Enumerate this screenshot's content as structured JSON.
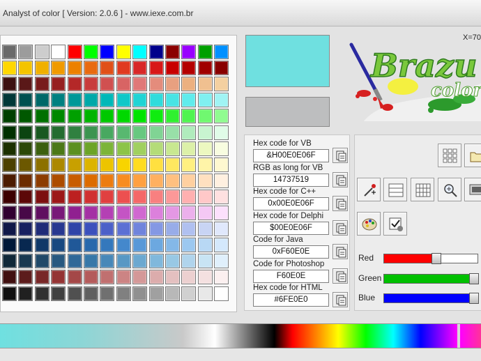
{
  "window": {
    "title": "Analyst of color [ Version: 2.0.6 ] - www.iexe.com.br"
  },
  "coordinates": "X=70",
  "logo": {
    "word1": "Brazu",
    "word2": "color"
  },
  "preview": {
    "selected_color": "#6FE0E0",
    "previous_color": "#BDBEBF"
  },
  "codes": [
    {
      "label": "Hex code for VB",
      "value": "&H00E0E06F"
    },
    {
      "label": "RGB as long for VB",
      "value": "14737519"
    },
    {
      "label": "Hex code for C++",
      "value": "0x00E0E06F"
    },
    {
      "label": "Hex code for Delphi",
      "value": "$00E0E06F"
    },
    {
      "label": "Code for Java",
      "value": "0xF60E0E"
    },
    {
      "label": "Code for Photoshop",
      "value": "F60E0E"
    },
    {
      "label": "Hex code for HTML",
      "value": "#6FE0E0"
    }
  ],
  "sliders": [
    {
      "label": "Red",
      "color": "#ff0000",
      "level": 0.55
    },
    {
      "label": "Green",
      "color": "#00c000",
      "level": 1.0
    },
    {
      "label": "Blue",
      "color": "#0000ff",
      "level": 1.0
    }
  ],
  "tools": [
    "grid-view-icon",
    "folder-icon",
    "eyedropper-icon",
    "list-view-icon",
    "small-grid-icon",
    "zoom-icon",
    "monitor-icon",
    "paint-palette-icon",
    "checkbox-options-icon"
  ],
  "palette_rows": [
    [
      "#6a6a6a",
      "#9c9c9c",
      "#cdcdcd",
      "#ffffff",
      "#ff0000",
      "#00ff00",
      "#0000ff",
      "#ffff00",
      "#00ffff",
      "#00008b",
      "#8b0000",
      "#9900ff",
      "#00a000",
      "#0090ff"
    ],
    [
      "#ffd700",
      "#f4c400",
      "#f0b000",
      "#f09a00",
      "#ec8000",
      "#e86a10",
      "#e05018",
      "#e03a20",
      "#d82828",
      "#d81818",
      "#c80000",
      "#b40000",
      "#a00000",
      "#880000"
    ],
    [
      "#3c1010",
      "#5a1818",
      "#781c1c",
      "#962020",
      "#b42828",
      "#c83c3c",
      "#d05050",
      "#d86464",
      "#e07878",
      "#e48c7c",
      "#e8a080",
      "#ecb080",
      "#f0c090",
      "#f4d0a0"
    ],
    [
      "#003838",
      "#005050",
      "#006868",
      "#008080",
      "#009898",
      "#00a8a8",
      "#00b8b8",
      "#10c8c8",
      "#20d4d4",
      "#30dcdc",
      "#48e4e4",
      "#60ecec",
      "#80f0f0",
      "#a0f4f4"
    ],
    [
      "#004000",
      "#005800",
      "#007000",
      "#008800",
      "#00a000",
      "#00b400",
      "#00c800",
      "#00d800",
      "#00e400",
      "#10ec10",
      "#30f030",
      "#50f450",
      "#70f870",
      "#90fc90"
    ],
    [
      "#003000",
      "#0c4410",
      "#185820",
      "#246c30",
      "#308040",
      "#3c9450",
      "#48a860",
      "#58b870",
      "#68c880",
      "#80d494",
      "#98e0a8",
      "#b0ecbc",
      "#c8f4d0",
      "#e0fce8"
    ],
    [
      "#1c3000",
      "#2c4808",
      "#3c6010",
      "#4c7818",
      "#5c9020",
      "#6ca428",
      "#7cb438",
      "#8cc448",
      "#a0d060",
      "#b4dc78",
      "#c8e890",
      "#dcf0a8",
      "#ecf8c0",
      "#f8fde0"
    ],
    [
      "#4c4000",
      "#6c5800",
      "#8c7000",
      "#ac8800",
      "#c8a000",
      "#dcb400",
      "#ecc400",
      "#f8d400",
      "#ffdc20",
      "#ffe040",
      "#ffe860",
      "#fff080",
      "#fff4a8",
      "#fff8d0"
    ],
    [
      "#4c1c00",
      "#6c2c00",
      "#8c3c00",
      "#ac4c00",
      "#c85c00",
      "#dc6c00",
      "#ec7c10",
      "#f88c20",
      "#ffa040",
      "#ffb060",
      "#ffc080",
      "#ffd0a0",
      "#ffe0c0",
      "#fff0e0"
    ],
    [
      "#3c0000",
      "#5c0808",
      "#7c1010",
      "#9c1818",
      "#bc2020",
      "#d03030",
      "#e04040",
      "#ec5050",
      "#f46868",
      "#f88080",
      "#fc9898",
      "#ffb0b0",
      "#ffc8c8",
      "#ffe0e0"
    ],
    [
      "#300030",
      "#480848",
      "#601060",
      "#781878",
      "#902090",
      "#a430a4",
      "#b440b4",
      "#c454c4",
      "#d068d0",
      "#dc80dc",
      "#e498e4",
      "#ecb0ec",
      "#f4c8f4",
      "#fce0fc"
    ],
    [
      "#101848",
      "#182060",
      "#202c78",
      "#283890",
      "#3044a8",
      "#3c50bc",
      "#4c60c8",
      "#5c70d4",
      "#7084dc",
      "#8498e4",
      "#98ace8",
      "#b0c0f0",
      "#c8d4f4",
      "#e0e8fc"
    ],
    [
      "#001838",
      "#082850",
      "#103868",
      "#184880",
      "#205898",
      "#2868ac",
      "#3478bc",
      "#4488cc",
      "#5898d8",
      "#6ca8e0",
      "#84b8e8",
      "#9cc8f0",
      "#b8d8f4",
      "#d4e8fc"
    ],
    [
      "#102838",
      "#183850",
      "#204868",
      "#285880",
      "#306898",
      "#3878a8",
      "#4888b8",
      "#5898c4",
      "#6ca8d0",
      "#80b8dc",
      "#98c8e4",
      "#b0d4ec",
      "#c8e4f4",
      "#e0f0fc"
    ],
    [
      "#401010",
      "#5c1c1c",
      "#782828",
      "#943434",
      "#a44848",
      "#b45c5c",
      "#c07070",
      "#cc8484",
      "#d49898",
      "#dcacac",
      "#e4c0c0",
      "#ecd0d0",
      "#f4e0e0",
      "#fcf0f0"
    ],
    [
      "#101010",
      "#202020",
      "#303030",
      "#404040",
      "#505050",
      "#606060",
      "#707070",
      "#808080",
      "#909090",
      "#a0a0a0",
      "#b8b8b8",
      "#d0d0d0",
      "#e8e8e8",
      "#ffffff"
    ]
  ]
}
